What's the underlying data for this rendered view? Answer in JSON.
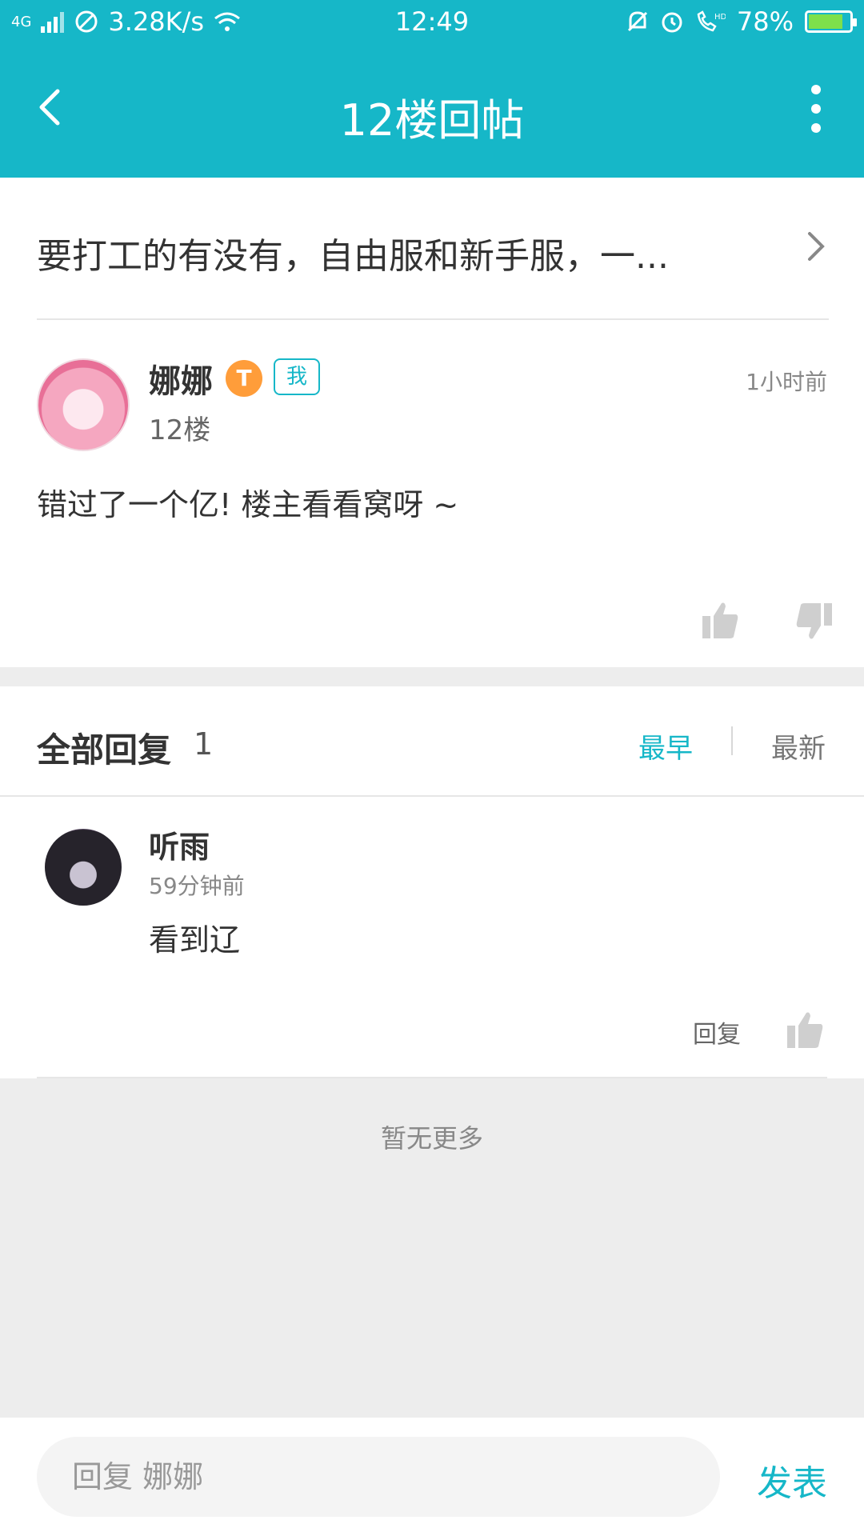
{
  "status_bar": {
    "network": "4G",
    "speed": "3.28K/s",
    "time": "12:49",
    "battery": "78%",
    "battery_level": 0.78
  },
  "header": {
    "title": "12楼回帖"
  },
  "thread": {
    "title": "要打工的有没有，自由服和新手服，一..."
  },
  "post": {
    "author": "娜娜",
    "badge_level": "T",
    "me_tag": "我",
    "floor": "12楼",
    "time": "1小时前",
    "content": "错过了一个亿! 楼主看看窝呀 ~"
  },
  "replies": {
    "title": "全部回复",
    "count": "1",
    "sort_earliest": "最早",
    "sort_latest": "最新",
    "items": [
      {
        "author": "听雨",
        "time": "59分钟前",
        "content": "看到辽",
        "reply_label": "回复"
      }
    ]
  },
  "no_more": "暂无更多",
  "bottom_bar": {
    "placeholder": "回复 娜娜",
    "send_label": "发表"
  },
  "colors": {
    "accent": "#16b7c8",
    "background": "#ededed",
    "badge_orange": "#ff9d3a"
  },
  "icons": [
    "back-arrow-icon",
    "more-vertical-icon",
    "chevron-right-icon",
    "thumbs-up-icon",
    "thumbs-down-icon",
    "wifi-icon",
    "alarm-icon",
    "battery-icon"
  ]
}
